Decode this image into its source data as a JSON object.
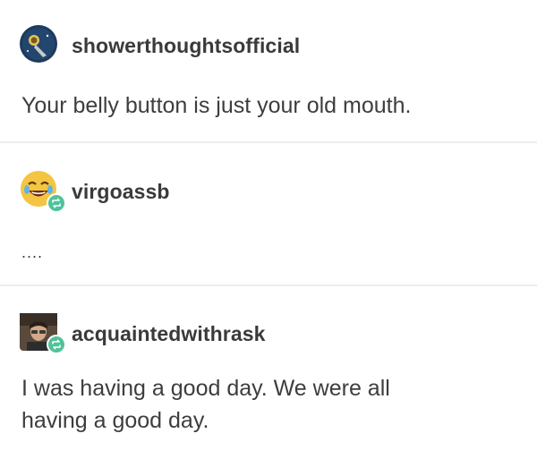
{
  "posts": [
    {
      "username": "showerthoughtsofficial",
      "text": "Your belly button is just your old mouth.",
      "avatar_icon": "astronaut-avatar",
      "reblog": false
    },
    {
      "username": "virgoassb",
      "text": "....",
      "avatar_icon": "laughing-emoji-avatar",
      "reblog": true
    },
    {
      "username": "acquaintedwithrask",
      "text_lines": [
        "I was having a good day. We were all",
        "having a good day."
      ],
      "avatar_icon": "person-photo-avatar",
      "reblog": true
    }
  ],
  "colors": {
    "reblog_badge": "#4fc29a",
    "divider": "#ececec",
    "text": "#3d3d3d"
  }
}
